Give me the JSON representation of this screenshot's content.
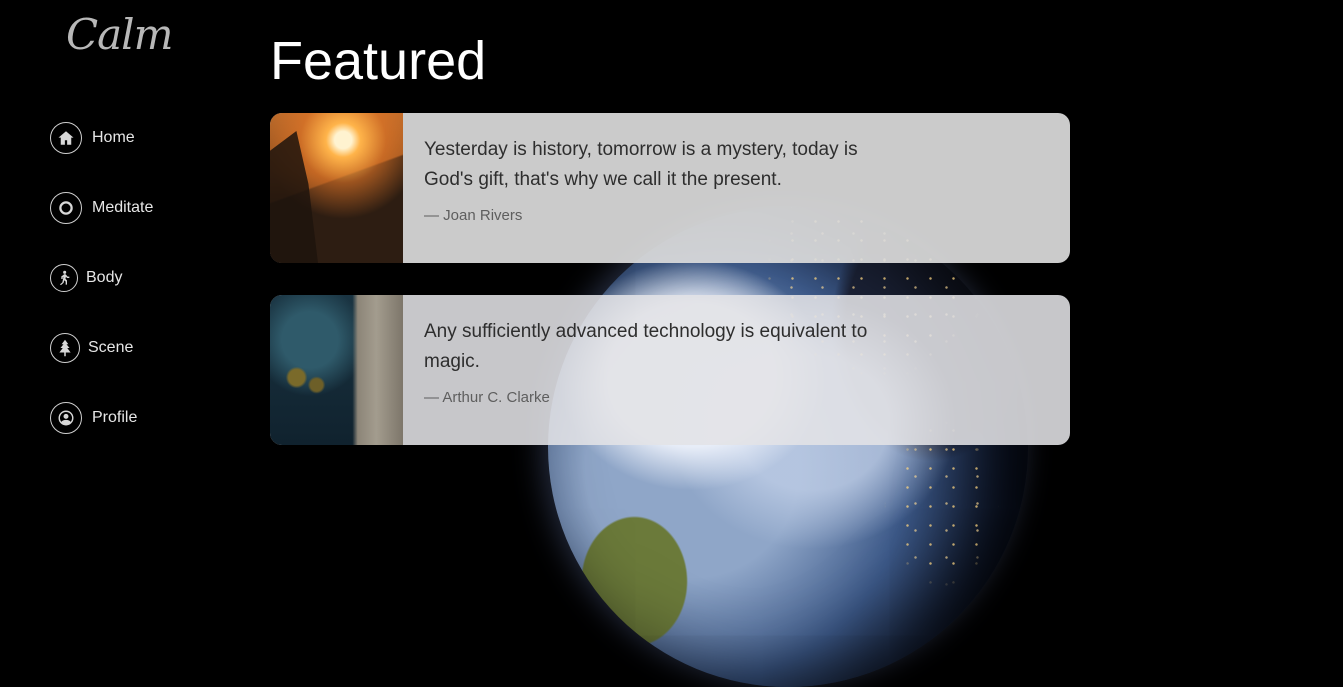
{
  "brand": {
    "logo_text": "Calm"
  },
  "sidebar": {
    "items": [
      {
        "label": "Home",
        "icon": "home-icon"
      },
      {
        "label": "Meditate",
        "icon": "circle-icon"
      },
      {
        "label": "Body",
        "icon": "walking-person-icon"
      },
      {
        "label": "Scene",
        "icon": "tree-icon"
      },
      {
        "label": "Profile",
        "icon": "user-circle-icon"
      }
    ]
  },
  "main": {
    "title": "Featured",
    "quotes": [
      {
        "text": "Yesterday is history, tomorrow is a mystery, today is God's gift, that's why we call it the present.",
        "author": "— Joan Rivers",
        "image": "sunset-cliffs"
      },
      {
        "text": "Any sufficiently advanced technology is equivalent to magic.",
        "author": "— Arthur C. Clarke",
        "image": "aerial-shoreline"
      }
    ]
  },
  "background": {
    "image": "earth-from-space"
  },
  "colors": {
    "background": "#000000",
    "card": "#dcdcdc",
    "text_dark": "#2e2e2e",
    "nav_text": "#e6e6e6"
  }
}
